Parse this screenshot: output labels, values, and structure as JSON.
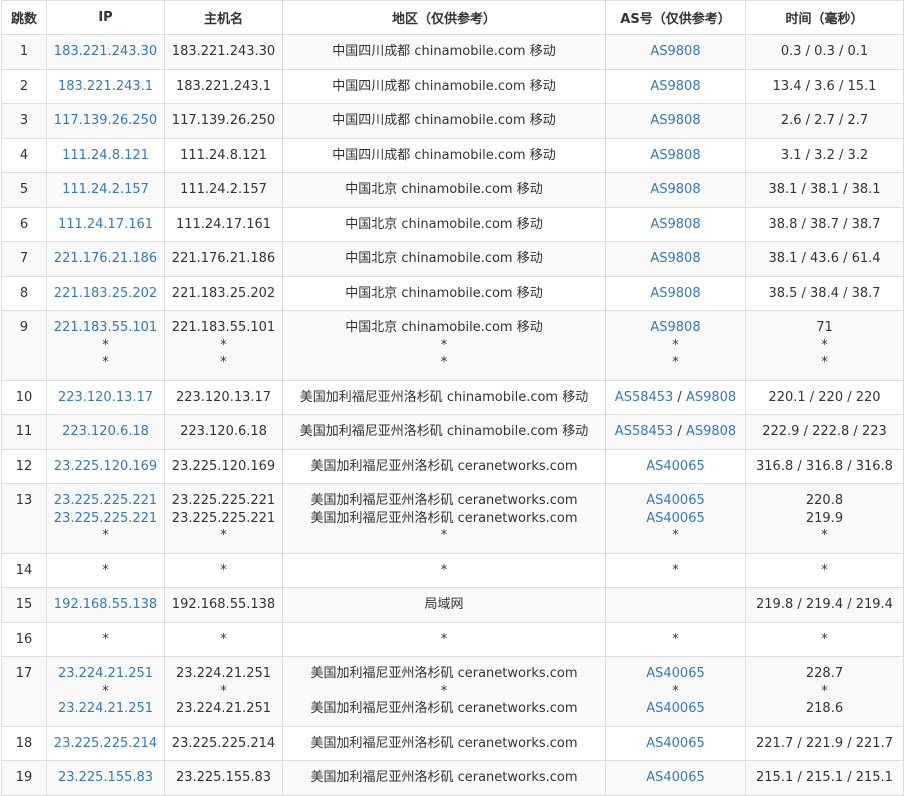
{
  "headers": [
    "跳数",
    "IP",
    "主机名",
    "地区（仅供参考）",
    "AS号（仅供参考）",
    "时间（毫秒）"
  ],
  "rows": [
    {
      "hop": "1",
      "ip": [
        "183.221.243.30"
      ],
      "host": [
        "183.221.243.30"
      ],
      "region": [
        "中国四川成都 chinamobile.com 移动"
      ],
      "asn": [
        [
          "AS9808"
        ]
      ],
      "time": [
        "0.3 / 0.3 / 0.1"
      ]
    },
    {
      "hop": "2",
      "ip": [
        "183.221.243.1"
      ],
      "host": [
        "183.221.243.1"
      ],
      "region": [
        "中国四川成都 chinamobile.com 移动"
      ],
      "asn": [
        [
          "AS9808"
        ]
      ],
      "time": [
        "13.4 / 3.6 / 15.1"
      ]
    },
    {
      "hop": "3",
      "ip": [
        "117.139.26.250"
      ],
      "host": [
        "117.139.26.250"
      ],
      "region": [
        "中国四川成都 chinamobile.com 移动"
      ],
      "asn": [
        [
          "AS9808"
        ]
      ],
      "time": [
        "2.6 / 2.7 / 2.7"
      ]
    },
    {
      "hop": "4",
      "ip": [
        "111.24.8.121"
      ],
      "host": [
        "111.24.8.121"
      ],
      "region": [
        "中国四川成都 chinamobile.com 移动"
      ],
      "asn": [
        [
          "AS9808"
        ]
      ],
      "time": [
        "3.1 / 3.2 / 3.2"
      ]
    },
    {
      "hop": "5",
      "ip": [
        "111.24.2.157"
      ],
      "host": [
        "111.24.2.157"
      ],
      "region": [
        "中国北京 chinamobile.com 移动"
      ],
      "asn": [
        [
          "AS9808"
        ]
      ],
      "time": [
        "38.1 / 38.1 / 38.1"
      ]
    },
    {
      "hop": "6",
      "ip": [
        "111.24.17.161"
      ],
      "host": [
        "111.24.17.161"
      ],
      "region": [
        "中国北京 chinamobile.com 移动"
      ],
      "asn": [
        [
          "AS9808"
        ]
      ],
      "time": [
        "38.8 / 38.7 / 38.7"
      ]
    },
    {
      "hop": "7",
      "ip": [
        "221.176.21.186"
      ],
      "host": [
        "221.176.21.186"
      ],
      "region": [
        "中国北京 chinamobile.com 移动"
      ],
      "asn": [
        [
          "AS9808"
        ]
      ],
      "time": [
        "38.1 / 43.6 / 61.4"
      ]
    },
    {
      "hop": "8",
      "ip": [
        "221.183.25.202"
      ],
      "host": [
        "221.183.25.202"
      ],
      "region": [
        "中国北京 chinamobile.com 移动"
      ],
      "asn": [
        [
          "AS9808"
        ]
      ],
      "time": [
        "38.5 / 38.4 / 38.7"
      ]
    },
    {
      "hop": "9",
      "ip": [
        "221.183.55.101",
        "*",
        "*"
      ],
      "host": [
        "221.183.55.101",
        "*",
        "*"
      ],
      "region": [
        "中国北京 chinamobile.com 移动",
        "*",
        "*"
      ],
      "asn": [
        [
          "AS9808"
        ],
        [
          "*"
        ],
        [
          "*"
        ]
      ],
      "time": [
        "71",
        "*",
        "*"
      ]
    },
    {
      "hop": "10",
      "ip": [
        "223.120.13.17"
      ],
      "host": [
        "223.120.13.17"
      ],
      "region": [
        "美国加利福尼亚州洛杉矶 chinamobile.com 移动"
      ],
      "asn": [
        [
          "AS58453",
          "AS9808"
        ]
      ],
      "time": [
        "220.1 / 220 / 220"
      ]
    },
    {
      "hop": "11",
      "ip": [
        "223.120.6.18"
      ],
      "host": [
        "223.120.6.18"
      ],
      "region": [
        "美国加利福尼亚州洛杉矶 chinamobile.com 移动"
      ],
      "asn": [
        [
          "AS58453",
          "AS9808"
        ]
      ],
      "time": [
        "222.9 / 222.8 / 223"
      ]
    },
    {
      "hop": "12",
      "ip": [
        "23.225.120.169"
      ],
      "host": [
        "23.225.120.169"
      ],
      "region": [
        "美国加利福尼亚州洛杉矶 ceranetworks.com"
      ],
      "asn": [
        [
          "AS40065"
        ]
      ],
      "time": [
        "316.8 / 316.8 / 316.8"
      ]
    },
    {
      "hop": "13",
      "ip": [
        "23.225.225.221",
        "23.225.225.221",
        "*"
      ],
      "host": [
        "23.225.225.221",
        "23.225.225.221",
        "*"
      ],
      "region": [
        "美国加利福尼亚州洛杉矶 ceranetworks.com",
        "美国加利福尼亚州洛杉矶 ceranetworks.com",
        "*"
      ],
      "asn": [
        [
          "AS40065"
        ],
        [
          "AS40065"
        ],
        [
          "*"
        ]
      ],
      "time": [
        "220.8",
        "219.9",
        "*"
      ]
    },
    {
      "hop": "14",
      "ip": [
        "*"
      ],
      "host": [
        "*"
      ],
      "region": [
        "*"
      ],
      "asn": [
        [
          "*"
        ]
      ],
      "time": [
        "*"
      ]
    },
    {
      "hop": "15",
      "ip": [
        "192.168.55.138"
      ],
      "host": [
        "192.168.55.138"
      ],
      "region": [
        "局域网"
      ],
      "asn": [],
      "time": [
        "219.8 / 219.4 / 219.4"
      ]
    },
    {
      "hop": "16",
      "ip": [
        "*"
      ],
      "host": [
        "*"
      ],
      "region": [
        "*"
      ],
      "asn": [
        [
          "*"
        ]
      ],
      "time": [
        "*"
      ]
    },
    {
      "hop": "17",
      "ip": [
        "23.224.21.251",
        "*",
        "23.224.21.251"
      ],
      "host": [
        "23.224.21.251",
        "*",
        "23.224.21.251"
      ],
      "region": [
        "美国加利福尼亚州洛杉矶 ceranetworks.com",
        "*",
        "美国加利福尼亚州洛杉矶 ceranetworks.com"
      ],
      "asn": [
        [
          "AS40065"
        ],
        [
          "*"
        ],
        [
          "AS40065"
        ]
      ],
      "time": [
        "228.7",
        "*",
        "218.6"
      ]
    },
    {
      "hop": "18",
      "ip": [
        "23.225.225.214"
      ],
      "host": [
        "23.225.225.214"
      ],
      "region": [
        "美国加利福尼亚州洛杉矶 ceranetworks.com"
      ],
      "asn": [
        [
          "AS40065"
        ]
      ],
      "time": [
        "221.7 / 221.9 / 221.7"
      ]
    },
    {
      "hop": "19",
      "ip": [
        "23.225.155.83"
      ],
      "host": [
        "23.225.155.83"
      ],
      "region": [
        "美国加利福尼亚州洛杉矶 ceranetworks.com"
      ],
      "asn": [
        [
          "AS40065"
        ]
      ],
      "time": [
        "215.1 / 215.1 / 215.1"
      ]
    }
  ],
  "colors": {
    "link": "#337ab7",
    "border": "#dddddd",
    "stripe": "#f9f9f9",
    "text": "#333333"
  }
}
